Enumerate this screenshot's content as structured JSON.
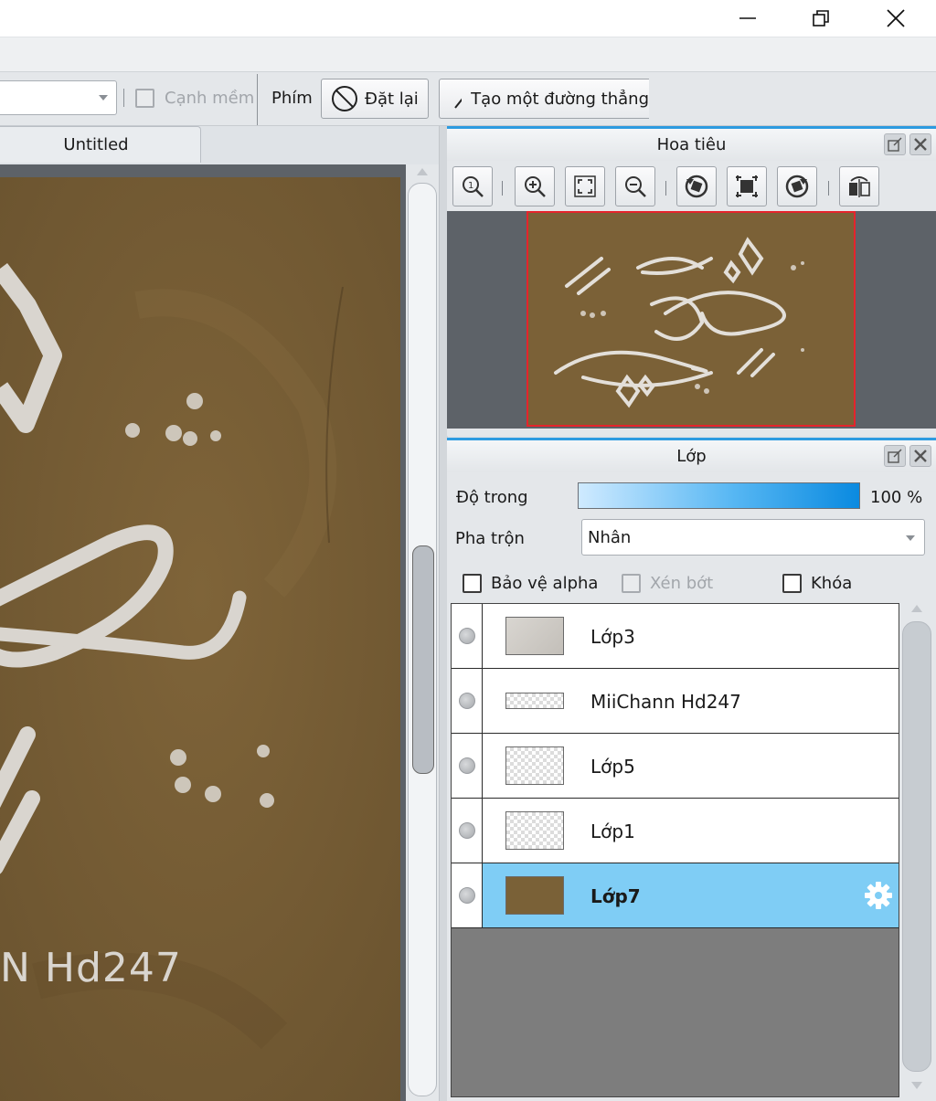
{
  "toolbar": {
    "soft_edge_label": "Cạnh mềm",
    "hotkey_label": "Phím",
    "reset_label": "Đặt lại",
    "straight_line_label": "Tạo một đường thẳng"
  },
  "document": {
    "tab_title": "Untitled",
    "watermark_text": "N Hd247"
  },
  "navigator": {
    "title": "Hoa tiêu"
  },
  "layers": {
    "title": "Lớp",
    "opacity_label": "Độ trong",
    "opacity_value": "100 %",
    "opacity_fraction": 1.0,
    "blend_label": "Pha trộn",
    "blend_value": "Nhân",
    "protect_alpha_label": "Bảo vệ alpha",
    "clipping_label": "Xén bớt",
    "lock_label": "Khóa",
    "items": [
      {
        "name": "Lớp3",
        "thumb": "paper",
        "selected": false
      },
      {
        "name": "MiiChann Hd247",
        "thumb": "checker-strip",
        "selected": false
      },
      {
        "name": "Lớp5",
        "thumb": "checker",
        "selected": false
      },
      {
        "name": "Lớp1",
        "thumb": "checker",
        "selected": false
      },
      {
        "name": "Lớp7",
        "thumb": "brown",
        "selected": true
      }
    ]
  },
  "colors": {
    "accent": "#2d9be0",
    "selection": "#7fcdf5",
    "canvas_paper": "#7a6137",
    "navigator_frame": "#e5242c"
  }
}
